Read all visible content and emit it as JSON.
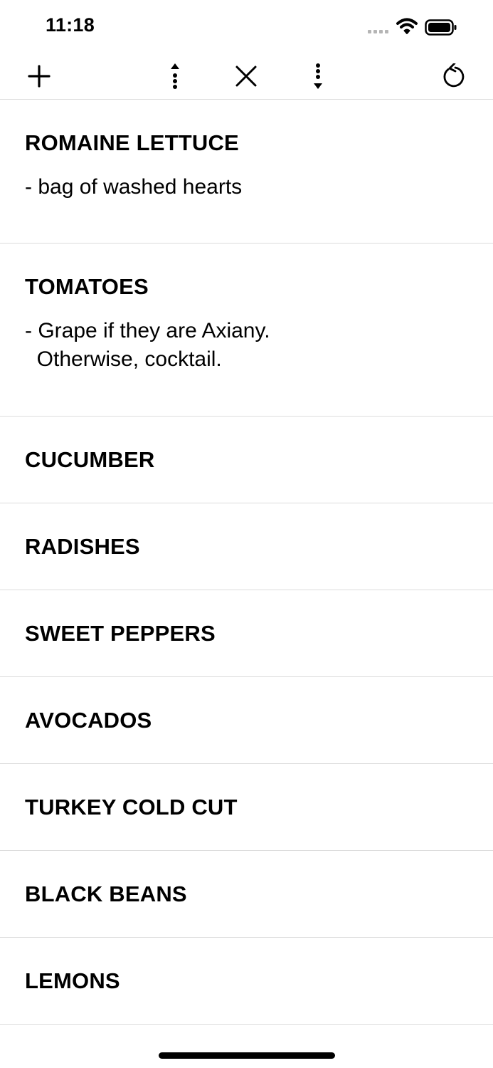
{
  "status_bar": {
    "time": "11:18",
    "icons": [
      "cellular-signal-icon",
      "wifi-icon",
      "battery-icon"
    ]
  },
  "toolbar": {
    "buttons": [
      {
        "name": "add-button",
        "icon": "plus-icon"
      },
      {
        "name": "move-to-top-button",
        "icon": "arrow-up-dotted-icon"
      },
      {
        "name": "clear-button",
        "icon": "x-icon"
      },
      {
        "name": "move-to-bottom-button",
        "icon": "arrow-down-dotted-icon"
      },
      {
        "name": "reset-button",
        "icon": "rotate-ccw-icon"
      }
    ]
  },
  "items": [
    {
      "title": "ROMAINE LETTUCE",
      "note": "- bag of washed hearts"
    },
    {
      "title": "TOMATOES",
      "note": "- Grape if they are Axiany.\n  Otherwise, cocktail."
    },
    {
      "title": "CUCUMBER"
    },
    {
      "title": "RADISHES"
    },
    {
      "title": "SWEET PEPPERS"
    },
    {
      "title": "AVOCADOS"
    },
    {
      "title": "TURKEY COLD CUT"
    },
    {
      "title": "BLACK BEANS"
    },
    {
      "title": "LEMONS"
    }
  ]
}
